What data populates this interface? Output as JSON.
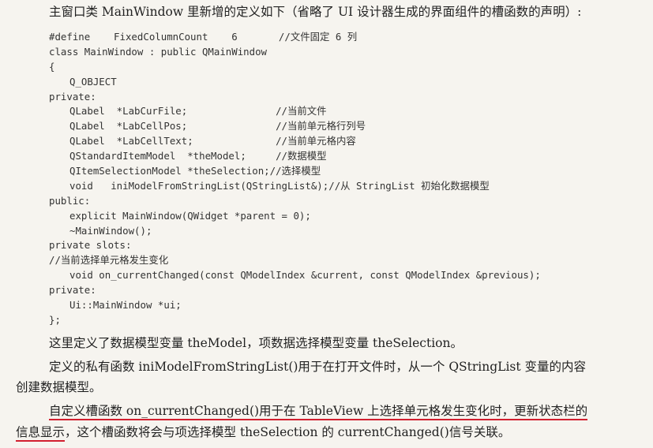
{
  "intro": "主窗口类 MainWindow 里新增的定义如下（省略了 UI 设计器生成的界面组件的槽函数的声明）:",
  "code_lines": [
    {
      "text": "#define    FixedColumnCount    6       //文件固定 6 列",
      "indent": 0
    },
    {
      "text": "class MainWindow : public QMainWindow",
      "indent": 0
    },
    {
      "text": "{",
      "indent": 0
    },
    {
      "text": "Q_OBJECT",
      "indent": 1
    },
    {
      "text": "private:",
      "indent": 0
    },
    {
      "text": "QLabel  *LabCurFile;               //当前文件",
      "indent": 1
    },
    {
      "text": "QLabel  *LabCellPos;               //当前单元格行列号",
      "indent": 1
    },
    {
      "text": "QLabel  *LabCellText;              //当前单元格内容",
      "indent": 1
    },
    {
      "text": "QStandardItemModel  *theModel;     //数据模型",
      "indent": 1
    },
    {
      "text": "QItemSelectionModel *theSelection;//选择模型",
      "indent": 1
    },
    {
      "text": "void   iniModelFromStringList(QStringList&);//从 StringList 初始化数据模型",
      "indent": 1
    },
    {
      "text": "public:",
      "indent": 0
    },
    {
      "text": "explicit MainWindow(QWidget *parent = 0);",
      "indent": 1
    },
    {
      "text": "~MainWindow();",
      "indent": 1
    },
    {
      "text": "private slots:",
      "indent": 0
    },
    {
      "text": "//当前选择单元格发生变化",
      "indent": 0
    },
    {
      "text": "void on_currentChanged(const QModelIndex &current, const QModelIndex &previous);",
      "indent": 1
    },
    {
      "text": "private:",
      "indent": 0
    },
    {
      "text": "Ui::MainWindow *ui;",
      "indent": 1
    },
    {
      "text": "};",
      "indent": 0
    }
  ],
  "para1": "这里定义了数据模型变量 theModel，项数据选择模型变量 theSelection。",
  "para2_line1": "定义的私有函数 iniModelFromStringList()用于在打开文件时，从一个 QStringList 变量的内容",
  "para2_line2": "创建数据模型。",
  "para3_line1": "自定义槽函数 on_currentChanged()用于在 TableView 上选择单元格发生变化时，更新状态栏的",
  "para3_line2_underlined": "信息显示",
  "para3_line2_rest": "，这个槽函数将会与项选择模型 theSelection 的 currentChanged()信号关联。",
  "colors": {
    "background": "#f6f4ef",
    "text": "#222222",
    "underline": "#d21f2f"
  }
}
